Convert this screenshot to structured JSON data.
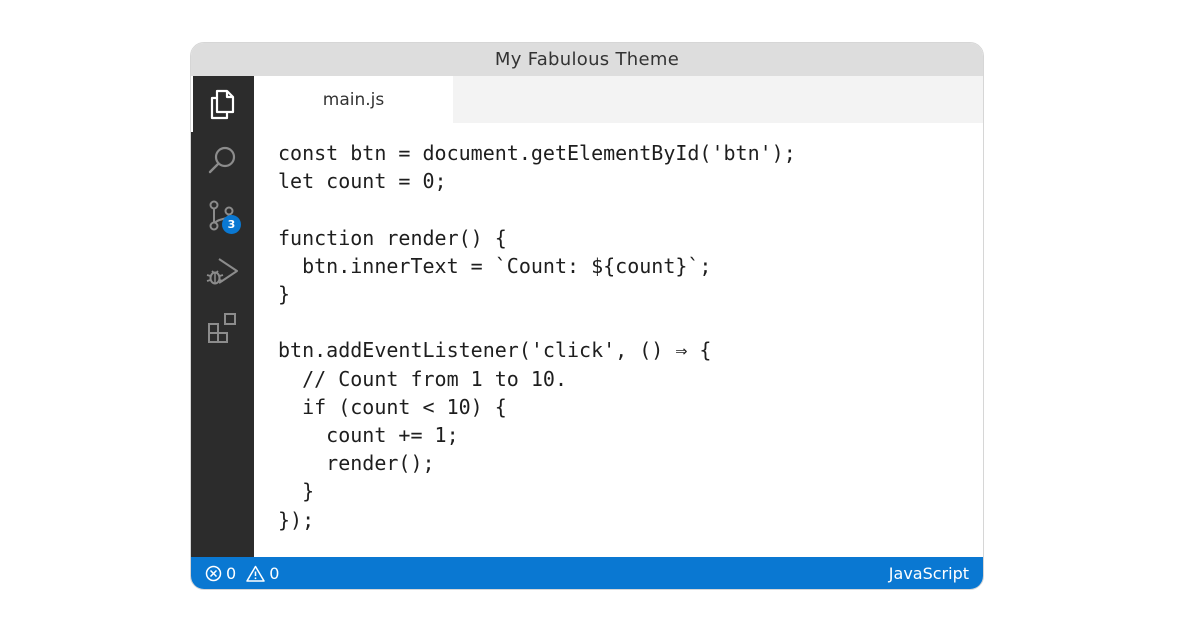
{
  "window": {
    "title": "My Fabulous Theme"
  },
  "activity_bar": {
    "items": [
      {
        "icon": "explorer-icon",
        "active": true
      },
      {
        "icon": "search-icon",
        "active": false
      },
      {
        "icon": "source-control-icon",
        "active": false,
        "badge": "3"
      },
      {
        "icon": "run-debug-icon",
        "active": false
      },
      {
        "icon": "extensions-icon",
        "active": false
      }
    ]
  },
  "tabs": [
    {
      "label": "main.js",
      "active": true
    }
  ],
  "editor": {
    "lines": [
      "const btn = document.getElementById('btn');",
      "let count = 0;",
      "",
      "function render() {",
      "  btn.innerText = `Count: ${count}`;",
      "}",
      "",
      "btn.addEventListener('click', () ⇒ {",
      "  // Count from 1 to 10.",
      "  if (count < 10) {",
      "    count += 1;",
      "    render();",
      "  }",
      "});"
    ]
  },
  "status_bar": {
    "errors": "0",
    "warnings": "0",
    "language": "JavaScript",
    "color": "#0a78d2"
  }
}
